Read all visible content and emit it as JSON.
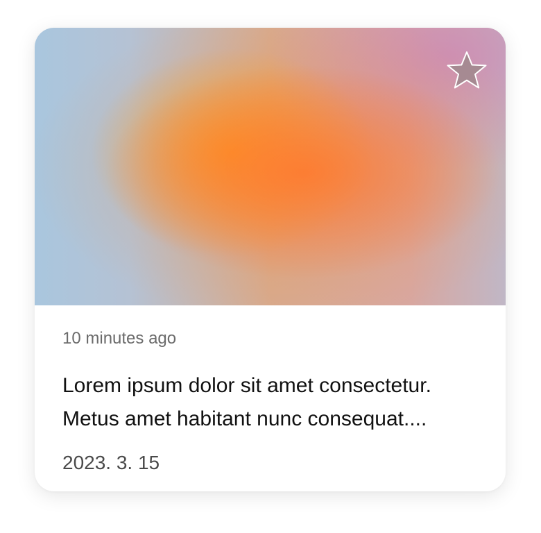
{
  "card": {
    "relative_time": "10 minutes ago",
    "title": "Lorem ipsum dolor sit amet consectetur. Metus amet habitant nunc consequat....",
    "date": "2023. 3. 15",
    "favorite_icon": "star-icon",
    "favorite_active": false
  },
  "colors": {
    "thumbnail_primary": "#ff8a1f",
    "thumbnail_secondary": "#f7a21b",
    "thumbnail_edge": "#a9c6de",
    "star_fill": "#a68a92",
    "star_stroke": "#ffffff"
  }
}
